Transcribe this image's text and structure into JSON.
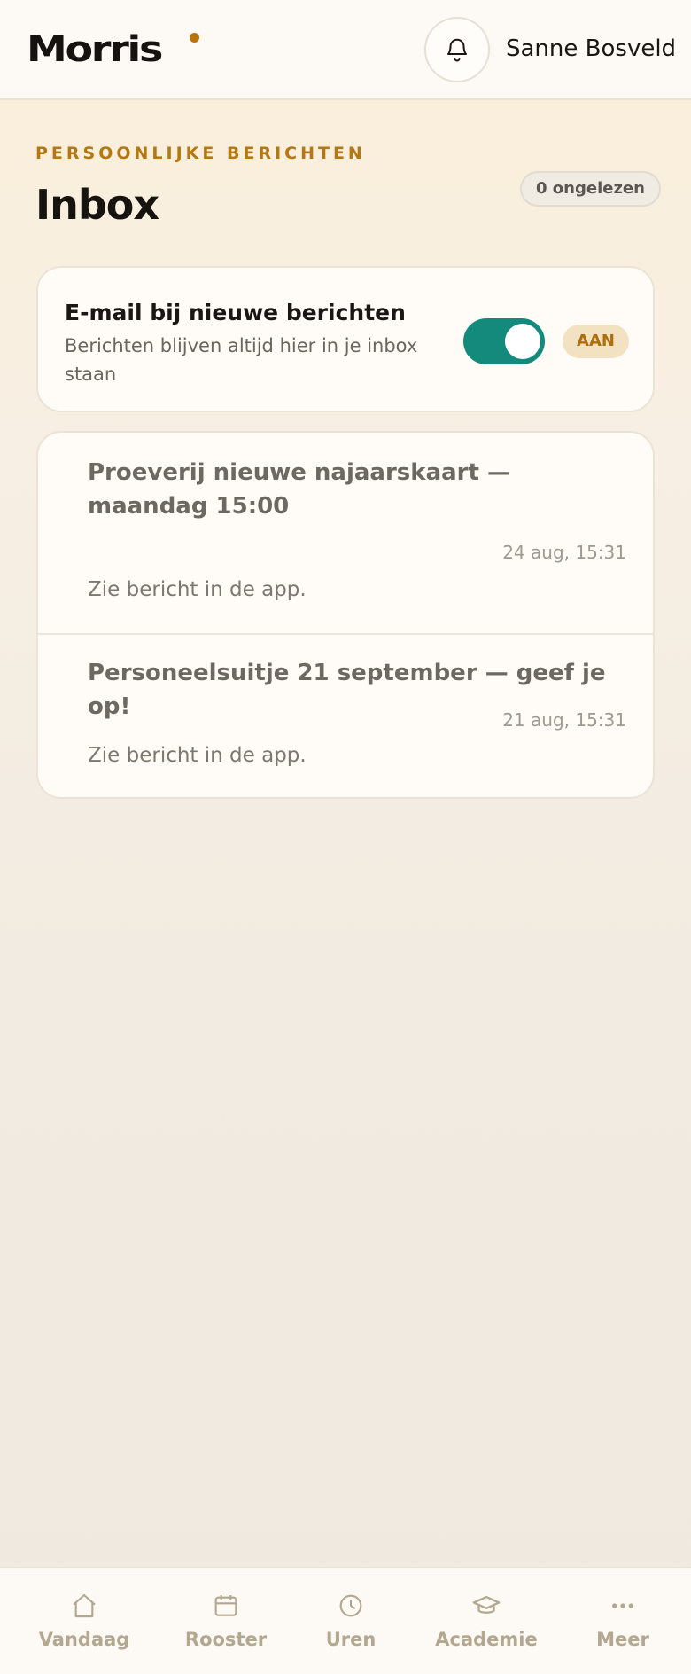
{
  "header": {
    "logo_text": "Morris",
    "notifications_icon": "bell-icon",
    "user_name": "Sanne Bosveld"
  },
  "page": {
    "eyebrow": "PERSOONLIJKE BERICHTEN",
    "title": "Inbox",
    "unread_badge": "0 ongelezen"
  },
  "email_setting": {
    "title": "E-mail bij nieuwe berichten",
    "subtitle": "Berichten blijven altijd hier in je inbox staan",
    "toggle_on": true,
    "state_label": "AAN"
  },
  "messages": [
    {
      "title": "Proeverij nieuwe najaarskaart — maandag 15:00",
      "time": "24 aug, 15:31",
      "body": "Zie bericht in de app."
    },
    {
      "title": "Personeelsuitje 21 september — geef je op!",
      "time": "21 aug, 15:31",
      "body": "Zie bericht in de app."
    }
  ],
  "tabs": [
    {
      "label": "Vandaag",
      "icon": "home-icon"
    },
    {
      "label": "Rooster",
      "icon": "calendar-icon"
    },
    {
      "label": "Uren",
      "icon": "clock-icon"
    },
    {
      "label": "Academie",
      "icon": "graduation-cap-icon"
    },
    {
      "label": "Meer",
      "icon": "more-dots-icon"
    }
  ],
  "colors": {
    "accent": "#b5770f",
    "toggle_on": "#138a7c",
    "tab_inactive": "#b3a78f"
  }
}
